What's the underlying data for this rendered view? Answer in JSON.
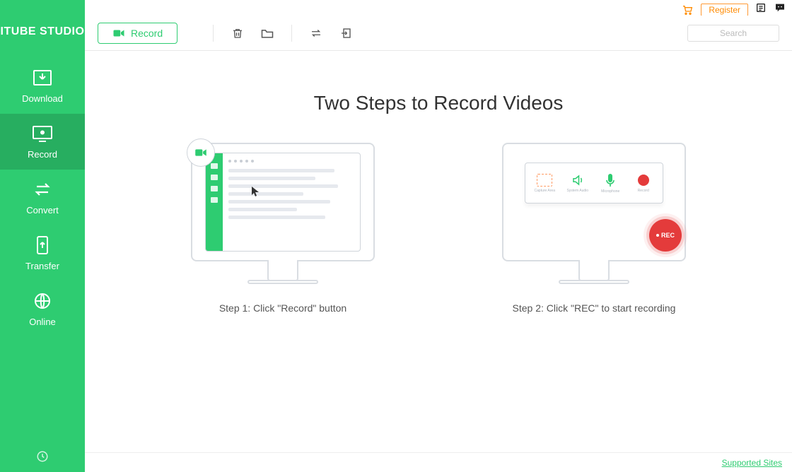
{
  "app": {
    "name": "ITUBE STUDIO"
  },
  "topbar": {
    "register_label": "Register",
    "search_placeholder": "Search"
  },
  "sidebar": {
    "items": [
      {
        "label": "Download"
      },
      {
        "label": "Record"
      },
      {
        "label": "Convert"
      },
      {
        "label": "Transfer"
      },
      {
        "label": "Online"
      }
    ]
  },
  "toolbar": {
    "record_button": "Record"
  },
  "content": {
    "title": "Two Steps to Record Videos",
    "step1_caption": "Step 1: Click \"Record\" button",
    "step2_caption": "Step 2: Click \"REC\" to start recording",
    "rec_badge": "REC",
    "panel_labels": {
      "a": "Capture Area",
      "b": "System Audio",
      "c": "Microphone",
      "d": "Record"
    }
  },
  "footer": {
    "supported_sites": "Supported Sites"
  }
}
